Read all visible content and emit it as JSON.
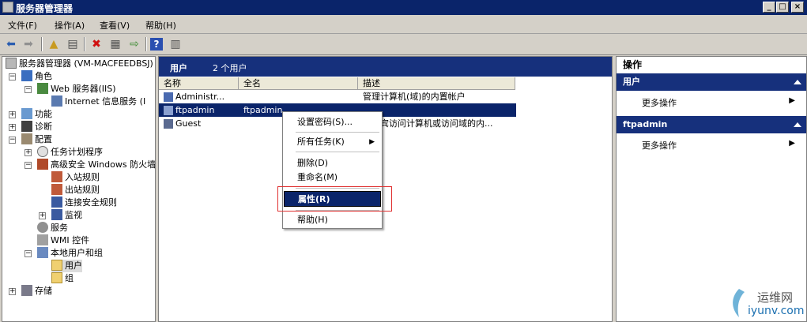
{
  "window": {
    "title": "服务器管理器"
  },
  "menu": [
    "文件(F)",
    "操作(A)",
    "查看(V)",
    "帮助(H)"
  ],
  "toolbar": {
    "icons": [
      "back-icon",
      "forward-icon",
      "up-folder-icon",
      "show-hide-tree-icon",
      "delete-icon",
      "properties-icon",
      "export-icon",
      "help-icon",
      "action-pane-icon"
    ]
  },
  "tree": {
    "root": "服务器管理器 (VM-MACFEEDBSJ)",
    "roles": "角色",
    "web_server": "Web 服务器(IIS)",
    "iis_manager": "Internet 信息服务 (I",
    "features": "功能",
    "diagnostics": "诊断",
    "configuration": "配置",
    "task_scheduler": "任务计划程序",
    "firewall": "高级安全 Windows 防火墙",
    "inbound": "入站规则",
    "outbound": "出站规则",
    "connection_security": "连接安全规则",
    "monitoring": "监视",
    "services": "服务",
    "wmi": "WMI 控件",
    "local_users_groups": "本地用户和组",
    "users": "用户",
    "groups": "组",
    "storage": "存储"
  },
  "center": {
    "title": "用户",
    "count": "2 个用户",
    "columns": [
      "名称",
      "全名",
      "描述"
    ],
    "rows": [
      {
        "name": "Administr...",
        "fullname": "",
        "description": "管理计算机(域)的内置帐户"
      },
      {
        "name": "ftpadmin",
        "fullname": "ftpadmin",
        "description": ""
      },
      {
        "name": "Guest",
        "fullname": "",
        "description": "宾访问计算机或访问域的内..."
      }
    ]
  },
  "context_menu": {
    "set_password": "设置密码(S)...",
    "all_tasks": "所有任务(K)",
    "delete": "删除(D)",
    "rename": "重命名(M)",
    "properties": "属性(R)",
    "help": "帮助(H)"
  },
  "actions": {
    "header": "操作",
    "section1": "用户",
    "section1_more": "更多操作",
    "section2": "ftpadmin",
    "section2_more": "更多操作"
  },
  "watermark": {
    "line1": "运维网",
    "line2": "iyunv.com"
  },
  "colors": {
    "selection": "#0a246a",
    "header_blue": "#16307c",
    "highlight_box": "#e03030"
  }
}
